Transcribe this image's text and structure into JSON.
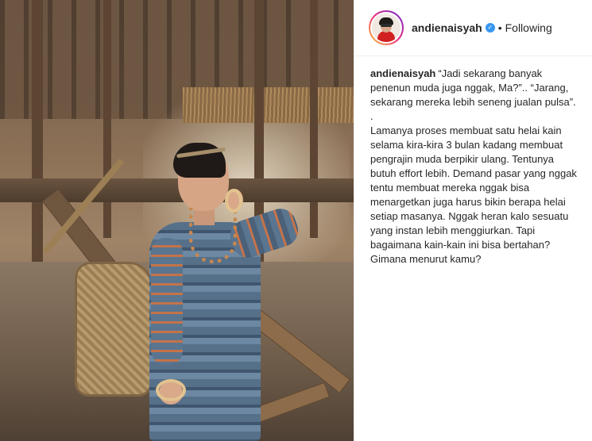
{
  "post": {
    "author": {
      "username": "andienaisyah",
      "verified": true,
      "follow_status": "Following",
      "separator": "•"
    },
    "caption": {
      "username": "andienaisyah",
      "paragraph_1": "“Jadi sekarang banyak penenun muda juga nggak, Ma?”.. “Jarang, sekarang mereka lebih seneng jualan pulsa”.",
      "paragraph_2": ".",
      "paragraph_3": "Lamanya proses membuat satu helai kain selama kira-kira 3 bulan kadang membuat pengrajin muda berpikir ulang. Tentunya butuh effort lebih. Demand pasar yang nggak tentu membuat mereka nggak bisa menargetkan juga harus bikin berapa helai setiap masanya. Nggak heran kalo sesuatu yang instan lebih menggiurkan. Tapi bagaimana kain-kain ini bisa bertahan? Gimana menurut kamu?"
    }
  },
  "icons": {
    "verified_badge": "verified-badge-icon",
    "avatar_ring": "story-ring"
  },
  "colors": {
    "verified_blue": "#3897f0",
    "text": "#262626",
    "divider": "#efefef"
  }
}
